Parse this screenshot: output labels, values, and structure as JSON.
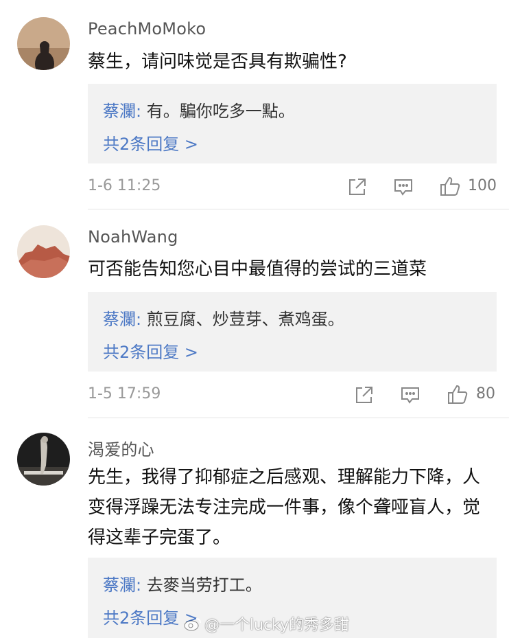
{
  "comments": [
    {
      "username": "PeachMoMoko",
      "text": "蔡生，请问味觉是否具有欺骗性?",
      "reply_author": "蔡瀾:",
      "reply_text": " 有。騙你吃多一點。",
      "reply_more": "共2条回复 >",
      "time": "1-6 11:25",
      "likes": "100"
    },
    {
      "username": "NoahWang",
      "text": "可否能告知您心目中最值得的尝试的三道菜",
      "reply_author": "蔡瀾:",
      "reply_text": " 煎豆腐、炒荳芽、煮鸡蛋。",
      "reply_more": "共2条回复 >",
      "time": "1-5 17:59",
      "likes": "80"
    },
    {
      "username": "渴爱的心",
      "text": "先生，我得了抑郁症之后感观、理解能力下降，人变得浮躁无法专注完成一件事，像个聋哑盲人，觉得这辈子完蛋了。",
      "reply_author": "蔡瀾:",
      "reply_text": " 去麥当劳打工。",
      "reply_more": "共2条回复 >"
    }
  ],
  "watermark": "@一个lucky的秀多甜",
  "icons": [
    "share-icon",
    "comment-icon",
    "like-icon"
  ]
}
